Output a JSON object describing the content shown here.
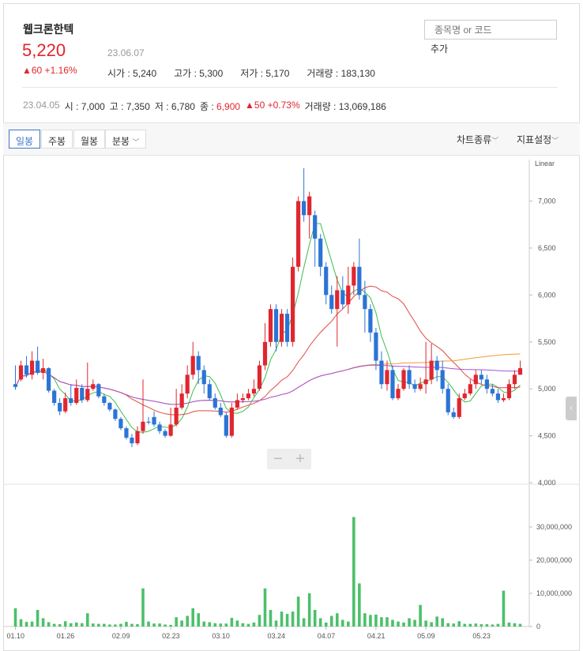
{
  "stock": {
    "name": "웹크론한텍",
    "price": "5,220",
    "change": "▲60 +1.16%",
    "date": "23.06.07",
    "open_label": "시가",
    "open": "5,240",
    "high_label": "고가",
    "high": "5,300",
    "low_label": "저가",
    "low": "5,170",
    "volume_label": "거래량",
    "volume": "183,130"
  },
  "search": {
    "placeholder": "종목명 or 코드",
    "add_label": "추가"
  },
  "history": {
    "date": "23.04.05",
    "open": "시 : 7,000",
    "high": "고 : 7,350",
    "low": "저 : 6,780",
    "close_label": "종 :",
    "close": "6,900",
    "change": "▲50 +0.73%",
    "volume": "거래량 : 13,069,186"
  },
  "toolbar": {
    "tabs": [
      "일봉",
      "주봉",
      "월봉",
      "분봉"
    ],
    "chart_type": "차트종류",
    "indicator": "지표설정"
  },
  "colors": {
    "up": "#e0262f",
    "down": "#2b74d6",
    "volume": "#4cc06a",
    "accent": "#3f75c6"
  },
  "chart_data": {
    "type": "candlestick",
    "scale_label": "Linear",
    "price_ticks": [
      "7,000",
      "6,500",
      "6,000",
      "5,500",
      "5,000",
      "4,500",
      "4,000"
    ],
    "volume_ticks": [
      "30,000,000",
      "20,000,000",
      "10,000,000",
      "0"
    ],
    "dates": [
      "01.10",
      "01.26",
      "02.09",
      "02.23",
      "03.10",
      "03.24",
      "04.07",
      "04.21",
      "05.09",
      "05.23"
    ],
    "candles": [
      [
        5050,
        5020,
        5250,
        4990
      ],
      [
        5100,
        5250,
        5300,
        5080
      ],
      [
        5250,
        5150,
        5350,
        5120
      ],
      [
        5150,
        5300,
        5400,
        5100
      ],
      [
        5300,
        5170,
        5450,
        5150
      ],
      [
        5170,
        5220,
        5320,
        5100
      ],
      [
        5220,
        4980,
        5230,
        4960
      ],
      [
        4980,
        4850,
        5000,
        4820
      ],
      [
        4850,
        4760,
        4900,
        4720
      ],
      [
        4760,
        4900,
        4960,
        4740
      ],
      [
        4900,
        4850,
        5050,
        4820
      ],
      [
        4850,
        5010,
        5100,
        4830
      ],
      [
        5010,
        4880,
        5050,
        4850
      ],
      [
        4880,
        5000,
        5280,
        4860
      ],
      [
        5000,
        5050,
        5100,
        4980
      ],
      [
        5050,
        4920,
        5060,
        4900
      ],
      [
        4920,
        4850,
        4950,
        4820
      ],
      [
        4850,
        4780,
        4860,
        4760
      ],
      [
        4780,
        4680,
        4790,
        4660
      ],
      [
        4680,
        4580,
        4700,
        4560
      ],
      [
        4580,
        4480,
        4600,
        4460
      ],
      [
        4480,
        4420,
        4520,
        4380
      ],
      [
        4420,
        4550,
        4600,
        4400
      ],
      [
        4550,
        4650,
        5100,
        4520
      ],
      [
        4650,
        4640,
        4700,
        4620
      ],
      [
        4700,
        4620,
        4760,
        4600
      ],
      [
        4620,
        4550,
        4650,
        4520
      ],
      [
        4550,
        4500,
        4570,
        4480
      ],
      [
        4500,
        4620,
        4800,
        4490
      ],
      [
        4620,
        4800,
        5000,
        4600
      ],
      [
        4800,
        4950,
        5050,
        4780
      ],
      [
        4950,
        5150,
        5250,
        4900
      ],
      [
        5150,
        5350,
        5500,
        5100
      ],
      [
        5350,
        5200,
        5400,
        5050
      ],
      [
        5200,
        5050,
        5250,
        4950
      ],
      [
        5050,
        4900,
        5100,
        4880
      ],
      [
        4900,
        4800,
        4950,
        4780
      ],
      [
        4800,
        4720,
        4850,
        4700
      ],
      [
        4720,
        4500,
        4750,
        4480
      ],
      [
        4500,
        4800,
        4850,
        4480
      ],
      [
        4800,
        4880,
        4950,
        4780
      ],
      [
        4880,
        4900,
        4950,
        4850
      ],
      [
        4900,
        4950,
        5000,
        4880
      ],
      [
        4950,
        5000,
        5100,
        4920
      ],
      [
        5000,
        5250,
        5300,
        4980
      ],
      [
        5250,
        5500,
        5700,
        5200
      ],
      [
        5500,
        5850,
        5900,
        5450
      ],
      [
        5850,
        5500,
        5900,
        5400
      ],
      [
        5500,
        5800,
        5850,
        5450
      ],
      [
        5800,
        5500,
        5850,
        5450
      ],
      [
        5500,
        6300,
        6400,
        5450
      ],
      [
        6300,
        7000,
        7050,
        6250
      ],
      [
        7000,
        6850,
        7350,
        6780
      ],
      [
        6850,
        7050,
        7100,
        6600
      ],
      [
        6850,
        6600,
        6900,
        6300
      ],
      [
        6600,
        6300,
        6650,
        6200
      ],
      [
        6300,
        6000,
        6350,
        5900
      ],
      [
        6000,
        5850,
        6100,
        5800
      ],
      [
        5850,
        6050,
        6200,
        5450
      ],
      [
        6050,
        5900,
        6200,
        5850
      ],
      [
        5900,
        6100,
        6300,
        5800
      ],
      [
        6100,
        6300,
        6350,
        6000
      ],
      [
        6300,
        6000,
        6600,
        5950
      ],
      [
        6000,
        5850,
        6150,
        5600
      ],
      [
        5850,
        5600,
        5900,
        5500
      ],
      [
        5600,
        5300,
        5650,
        5200
      ],
      [
        5300,
        5050,
        5400,
        5000
      ],
      [
        5050,
        5200,
        5300,
        4980
      ],
      [
        5200,
        4900,
        5250,
        4880
      ],
      [
        4900,
        5000,
        5050,
        4880
      ],
      [
        5000,
        5200,
        5220,
        4980
      ],
      [
        5200,
        5050,
        5250,
        5000
      ],
      [
        5050,
        5000,
        5100,
        4960
      ],
      [
        5000,
        5050,
        5120,
        4980
      ],
      [
        5050,
        5100,
        5500,
        4950
      ],
      [
        5100,
        5300,
        5480,
        5050
      ],
      [
        5300,
        5200,
        5350,
        5080
      ],
      [
        5200,
        5000,
        5300,
        4950
      ],
      [
        5000,
        4750,
        5050,
        4720
      ],
      [
        4750,
        4700,
        4800,
        4680
      ],
      [
        4700,
        4900,
        4950,
        4680
      ],
      [
        4900,
        4950,
        5000,
        4880
      ],
      [
        4950,
        5050,
        5100,
        4930
      ],
      [
        5050,
        5150,
        5200,
        5000
      ],
      [
        5150,
        5100,
        5200,
        5050
      ],
      [
        5100,
        5000,
        5150,
        4950
      ],
      [
        5000,
        4950,
        5050,
        4920
      ],
      [
        4950,
        4880,
        5000,
        4850
      ],
      [
        4880,
        4900,
        4950,
        4860
      ],
      [
        4900,
        5050,
        5100,
        4880
      ],
      [
        5050,
        5150,
        5200,
        5000
      ],
      [
        5150,
        5220,
        5300,
        5170
      ]
    ],
    "volumes_m": [
      5.5,
      2.2,
      1.4,
      1.5,
      5,
      2.5,
      1.3,
      0.8,
      0.7,
      1.6,
      1,
      1.2,
      1,
      4,
      0.9,
      0.8,
      0.8,
      0.6,
      0.6,
      0.8,
      1.4,
      0.8,
      0.7,
      11.5,
      1.5,
      0.9,
      0.9,
      0.6,
      0.5,
      2.8,
      1.8,
      3.2,
      5.5,
      4,
      1.5,
      1.3,
      1,
      0.9,
      0.9,
      2.6,
      1.8,
      1,
      0.8,
      1.2,
      3.5,
      11.5,
      5,
      1.8,
      4.5,
      3.8,
      4.5,
      9,
      2.5,
      10,
      5,
      2.5,
      1.2,
      3.2,
      4,
      2,
      1.5,
      33,
      13,
      4,
      3.5,
      3.6,
      2.8,
      2.8,
      2,
      1.5,
      1.2,
      2.5,
      2,
      6.5,
      1.8,
      1.3,
      3,
      2.5,
      1,
      0.9,
      1.6,
      0.8,
      0.8,
      0.9,
      0.7,
      0.7,
      0.6,
      0.8,
      10.8,
      1.2,
      1,
      0.8,
      0.8,
      0.7,
      0.6,
      0.6
    ]
  }
}
